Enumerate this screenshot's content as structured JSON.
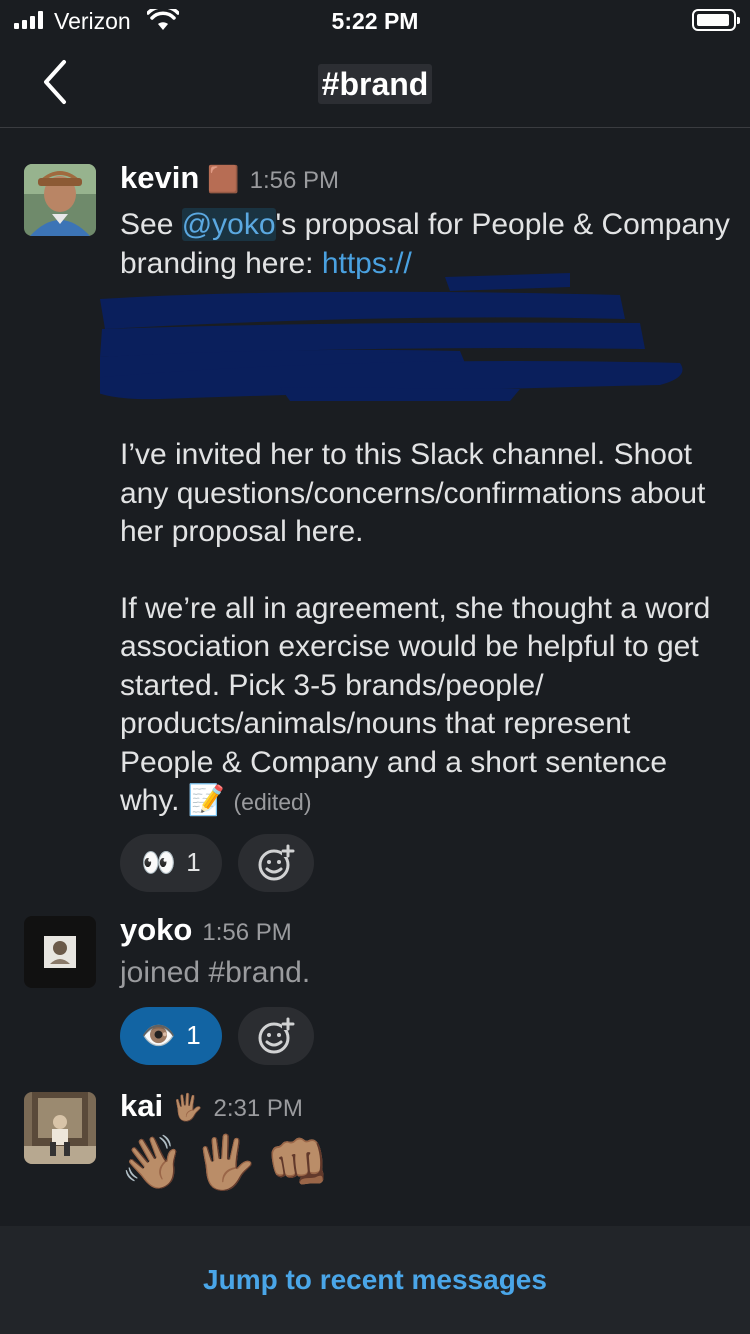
{
  "status": {
    "carrier": "Verizon",
    "time": "5:22 PM"
  },
  "nav": {
    "title": "#brand"
  },
  "messages": [
    {
      "author": "kevin",
      "author_emoji": "🟫",
      "time": "1:56 PM",
      "text_before_mention": "See ",
      "mention": "@yoko",
      "text_after_mention": "'s proposal for People & Company branding here: ",
      "link_partial": "https://",
      "paragraph2": "I’ve invited her to this Slack channel. Shoot any questions/concerns/confirmations about her proposal here.",
      "paragraph3": "If we’re all in agreement, she thought a word association exercise would be helpful to get started. Pick 3-5 brands/people/ products/animals/nouns that represent People & Company and a short sentence why.",
      "trailing_emoji": "📝",
      "edited": "(edited)",
      "reactions": [
        {
          "emoji": "👀",
          "count": "1",
          "active": false
        }
      ]
    },
    {
      "author": "yoko",
      "time": "1:56 PM",
      "text": "joined #brand.",
      "reactions": [
        {
          "emoji": "👁️",
          "count": "1",
          "active": true
        }
      ]
    },
    {
      "author": "kai",
      "author_emoji": "🖐🏽",
      "time": "2:31 PM",
      "emojis": "👋🏽🖐🏽👊🏽"
    }
  ],
  "footer": {
    "jump_label": "Jump to recent messages"
  },
  "colors": {
    "background": "#1a1d21",
    "link": "#4aa1e0",
    "active_reaction": "#1264a3",
    "redaction": "#0a1f5c"
  },
  "icons": [
    "signal-icon",
    "wifi-icon",
    "battery-icon",
    "back-chevron-icon",
    "add-reaction-icon"
  ]
}
